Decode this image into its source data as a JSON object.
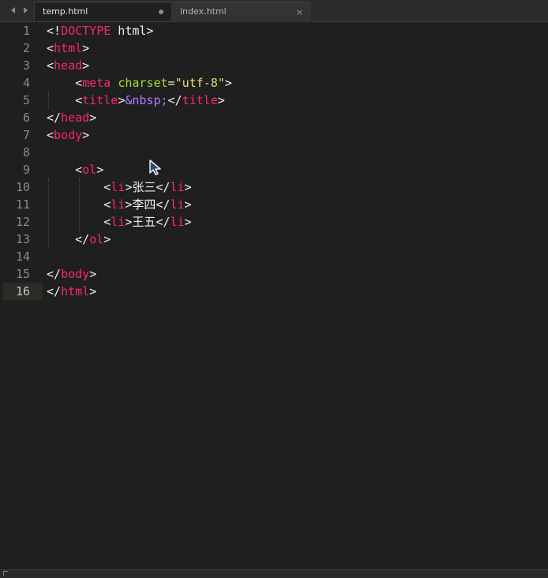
{
  "tabs": [
    {
      "label": "temp.html",
      "active": true,
      "dirty": true
    },
    {
      "label": "index.html",
      "active": false,
      "close_glyph": "×"
    }
  ],
  "navigation": {
    "prev_icon": "arrow-left-icon",
    "next_icon": "arrow-right-icon"
  },
  "editor": {
    "current_line": 16,
    "lines": [
      {
        "no": "1",
        "tokens": [
          {
            "t": "p",
            "v": "<!"
          },
          {
            "t": "tag",
            "v": "DOCTYPE"
          },
          {
            "t": "p",
            "v": " html>"
          }
        ]
      },
      {
        "no": "2",
        "tokens": [
          {
            "t": "p",
            "v": "<"
          },
          {
            "t": "tag",
            "v": "html"
          },
          {
            "t": "p",
            "v": ">"
          }
        ]
      },
      {
        "no": "3",
        "tokens": [
          {
            "t": "p",
            "v": "<"
          },
          {
            "t": "tag",
            "v": "head"
          },
          {
            "t": "p",
            "v": ">"
          }
        ]
      },
      {
        "no": "4",
        "tokens": [
          {
            "t": "p",
            "v": "    <"
          },
          {
            "t": "tag",
            "v": "meta"
          },
          {
            "t": "p",
            "v": " "
          },
          {
            "t": "attr",
            "v": "charset"
          },
          {
            "t": "p",
            "v": "="
          },
          {
            "t": "str",
            "v": "\"utf-8\""
          },
          {
            "t": "p",
            "v": ">"
          }
        ]
      },
      {
        "no": "5",
        "tokens": [
          {
            "t": "p",
            "v": "    <"
          },
          {
            "t": "tag",
            "v": "title"
          },
          {
            "t": "p",
            "v": ">"
          },
          {
            "t": "ent",
            "v": "&nbsp;"
          },
          {
            "t": "p",
            "v": "</"
          },
          {
            "t": "tag",
            "v": "title"
          },
          {
            "t": "p",
            "v": ">"
          }
        ]
      },
      {
        "no": "6",
        "tokens": [
          {
            "t": "p",
            "v": "</"
          },
          {
            "t": "tag",
            "v": "head"
          },
          {
            "t": "p",
            "v": ">"
          }
        ]
      },
      {
        "no": "7",
        "tokens": [
          {
            "t": "p",
            "v": "<"
          },
          {
            "t": "tag",
            "v": "body"
          },
          {
            "t": "p",
            "v": ">"
          }
        ]
      },
      {
        "no": "8",
        "tokens": []
      },
      {
        "no": "9",
        "tokens": [
          {
            "t": "p",
            "v": "    <"
          },
          {
            "t": "tag",
            "v": "ol"
          },
          {
            "t": "p",
            "v": ">"
          }
        ]
      },
      {
        "no": "10",
        "tokens": [
          {
            "t": "p",
            "v": "        <"
          },
          {
            "t": "tag",
            "v": "li"
          },
          {
            "t": "p",
            "v": ">张三</"
          },
          {
            "t": "tag",
            "v": "li"
          },
          {
            "t": "p",
            "v": ">"
          }
        ]
      },
      {
        "no": "11",
        "tokens": [
          {
            "t": "p",
            "v": "        <"
          },
          {
            "t": "tag",
            "v": "li"
          },
          {
            "t": "p",
            "v": ">李四</"
          },
          {
            "t": "tag",
            "v": "li"
          },
          {
            "t": "p",
            "v": ">"
          }
        ]
      },
      {
        "no": "12",
        "tokens": [
          {
            "t": "p",
            "v": "        <"
          },
          {
            "t": "tag",
            "v": "li"
          },
          {
            "t": "p",
            "v": ">王五</"
          },
          {
            "t": "tag",
            "v": "li"
          },
          {
            "t": "p",
            "v": ">"
          }
        ]
      },
      {
        "no": "13",
        "tokens": [
          {
            "t": "p",
            "v": "    </"
          },
          {
            "t": "tag",
            "v": "ol"
          },
          {
            "t": "p",
            "v": ">"
          }
        ]
      },
      {
        "no": "14",
        "tokens": []
      },
      {
        "no": "15",
        "tokens": [
          {
            "t": "p",
            "v": "</"
          },
          {
            "t": "tag",
            "v": "body"
          },
          {
            "t": "p",
            "v": ">"
          }
        ]
      },
      {
        "no": "16",
        "tokens": [
          {
            "t": "p",
            "v": "</"
          },
          {
            "t": "tag",
            "v": "html"
          },
          {
            "t": "p",
            "v": ">"
          }
        ]
      }
    ]
  },
  "colors": {
    "background": "#1f1f1f",
    "tag": "#f92672",
    "attribute": "#a6e22e",
    "string": "#e6db74",
    "entity": "#ae81ff",
    "text": "#f0f0f0",
    "line_number": "#8b8b8b"
  }
}
